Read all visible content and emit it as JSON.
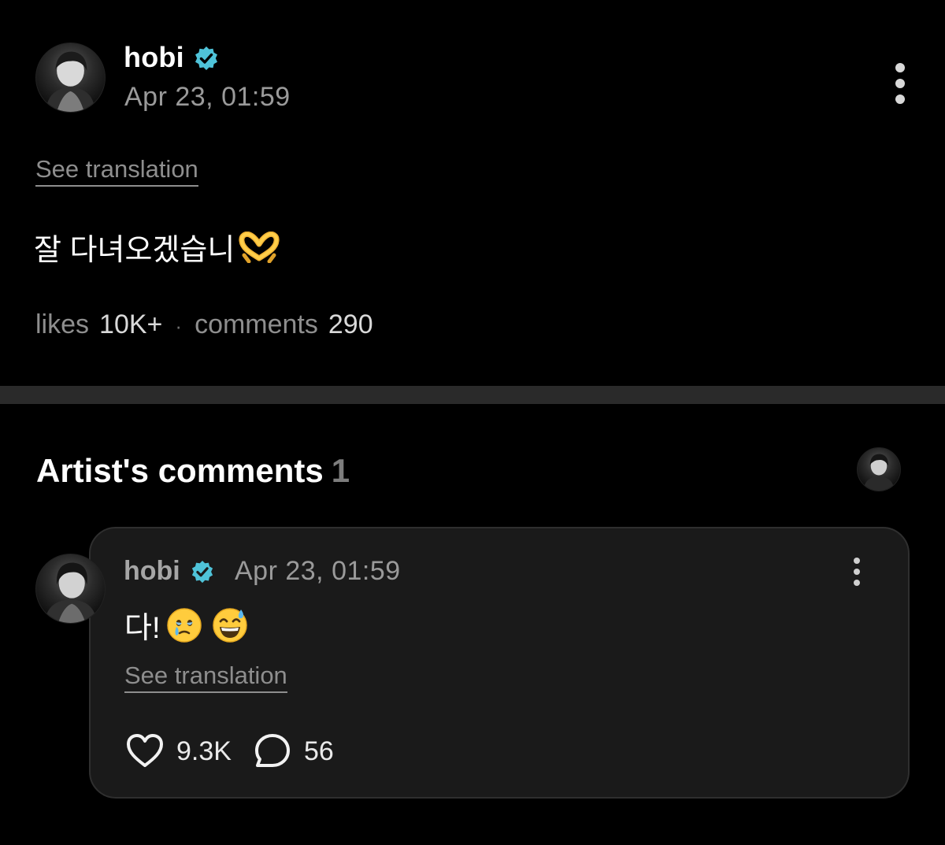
{
  "post": {
    "author": "hobi",
    "date": "Apr 23, 01:59",
    "see_translation": "See translation",
    "body_text": "잘 다녀오겠습니",
    "body_emoji": "heart-hands-emoji",
    "likes_label": "likes",
    "likes_count": "10K+",
    "separator": "·",
    "comments_label": "comments",
    "comments_count": "290"
  },
  "artist_comments": {
    "title": "Artist's comments",
    "count": "1",
    "comment": {
      "author": "hobi",
      "date": "Apr 23, 01:59",
      "text": "다!",
      "emojis": [
        "face-holding-back-tears-emoji",
        "grinning-face-with-sweat-emoji"
      ],
      "see_translation": "See translation",
      "like_count": "9.3K",
      "reply_count": "56"
    }
  },
  "colors": {
    "background": "#000000",
    "card": "#1a1a1a",
    "verified": "#4fc3d9",
    "muted_text": "#8e8e8e",
    "divider": "#2a2a2a"
  }
}
